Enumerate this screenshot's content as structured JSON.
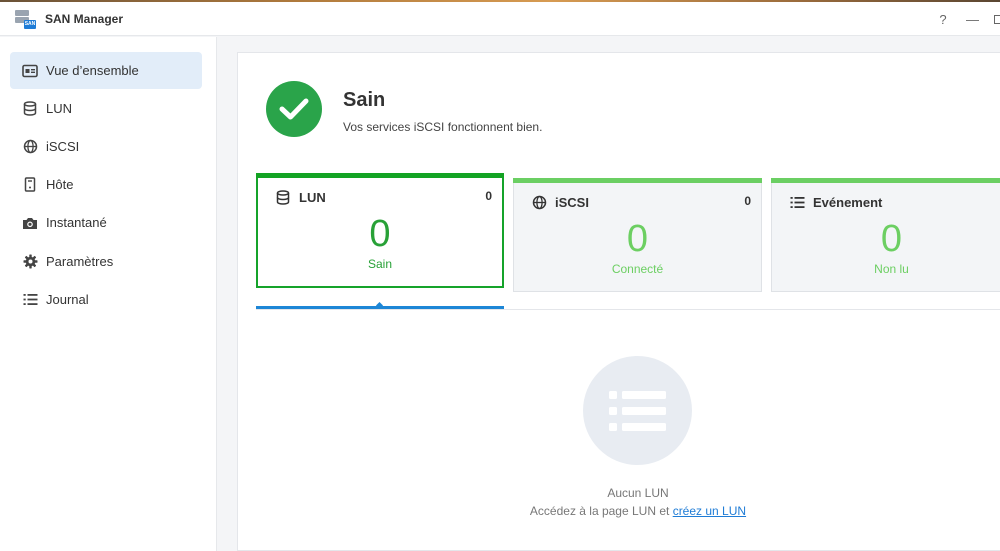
{
  "app": {
    "title": "SAN Manager",
    "badge": "SAN"
  },
  "window": {
    "help": "?",
    "minimize": "—"
  },
  "sidebar": {
    "items": [
      {
        "label": "Vue d’ensemble",
        "icon": "overview-icon"
      },
      {
        "label": "LUN",
        "icon": "database-icon"
      },
      {
        "label": "iSCSI",
        "icon": "globe-icon"
      },
      {
        "label": "Hôte",
        "icon": "host-icon"
      },
      {
        "label": "Instantané",
        "icon": "camera-icon"
      },
      {
        "label": "Paramètres",
        "icon": "gear-icon"
      },
      {
        "label": "Journal",
        "icon": "list-icon"
      }
    ]
  },
  "status": {
    "title": "Sain",
    "subtitle": "Vos services iSCSI fonctionnent bien.",
    "color": "#2aa44a"
  },
  "cards": [
    {
      "title": "LUN",
      "count": "0",
      "value": "0",
      "label": "Sain",
      "selected": true
    },
    {
      "title": "iSCSI",
      "count": "0",
      "value": "0",
      "label": "Connecté"
    },
    {
      "title": "Evénement",
      "count": "0",
      "value": "0",
      "label": "Non lu"
    }
  ],
  "empty": {
    "title": "Aucun LUN",
    "prefix": "Accédez à la page LUN et ",
    "link": "créez un LUN"
  },
  "colors": {
    "accent": "#1d86d6",
    "healthy": "#28a137",
    "light_green": "#6ccf62"
  }
}
